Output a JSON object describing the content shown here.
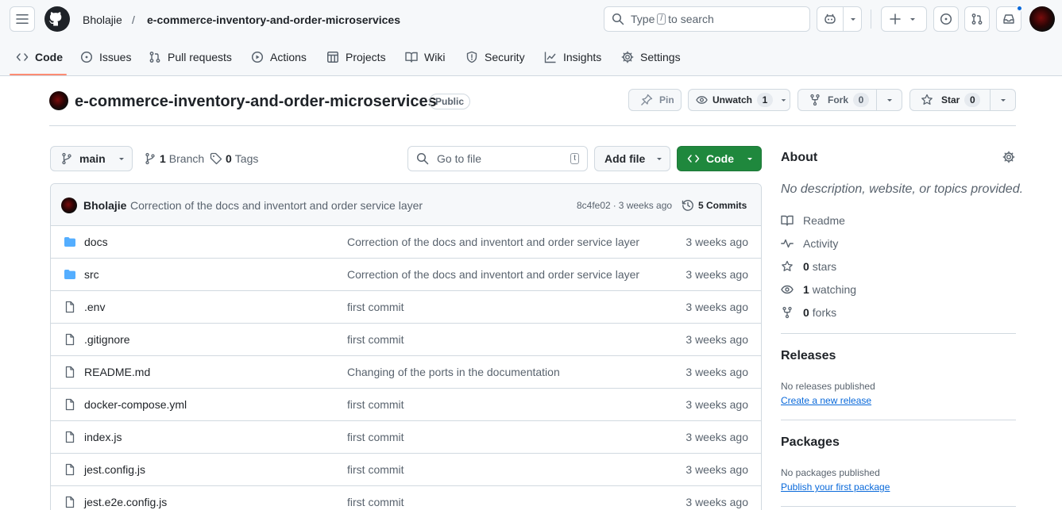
{
  "header": {
    "owner": "Bholajie",
    "separator": "/",
    "repo": "e-commerce-inventory-and-order-microservices",
    "search": {
      "prefix": "Type",
      "key": "/",
      "suffix": "to search"
    }
  },
  "tabs": [
    {
      "label": "Code",
      "icon": "code-icon",
      "active": true
    },
    {
      "label": "Issues",
      "icon": "issue-icon"
    },
    {
      "label": "Pull requests",
      "icon": "pull-request-icon"
    },
    {
      "label": "Actions",
      "icon": "play-icon"
    },
    {
      "label": "Projects",
      "icon": "table-icon"
    },
    {
      "label": "Wiki",
      "icon": "book-icon"
    },
    {
      "label": "Security",
      "icon": "shield-icon"
    },
    {
      "label": "Insights",
      "icon": "graph-icon"
    },
    {
      "label": "Settings",
      "icon": "gear-icon"
    }
  ],
  "repo": {
    "title": "e-commerce-inventory-and-order-microservices",
    "visibility": "Public",
    "actions": {
      "pin": "Pin",
      "unwatch": "Unwatch",
      "watch_count": "1",
      "fork": "Fork",
      "fork_count": "0",
      "star": "Star",
      "star_count": "0"
    }
  },
  "toolbar": {
    "branch": "main",
    "branches_count": "1",
    "branches_label": "Branch",
    "tags_count": "0",
    "tags_label": "Tags",
    "goto_placeholder": "Go to file",
    "goto_key": "t",
    "add_file": "Add file",
    "code": "Code"
  },
  "latest_commit": {
    "author": "Bholajie",
    "message": "Correction of the docs and inventort and order service layer",
    "hash": "8c4fe02",
    "dot": "·",
    "time": "3 weeks ago",
    "commits": "5 Commits"
  },
  "files": [
    {
      "name": "docs",
      "type": "dir",
      "message": "Correction of the docs and inventort and order service layer",
      "date": "3 weeks ago"
    },
    {
      "name": "src",
      "type": "dir",
      "message": "Correction of the docs and inventort and order service layer",
      "date": "3 weeks ago"
    },
    {
      "name": ".env",
      "type": "file",
      "message": "first commit",
      "date": "3 weeks ago"
    },
    {
      "name": ".gitignore",
      "type": "file",
      "message": "first commit",
      "date": "3 weeks ago"
    },
    {
      "name": "README.md",
      "type": "file",
      "message": "Changing of the ports in the documentation",
      "date": "3 weeks ago"
    },
    {
      "name": "docker-compose.yml",
      "type": "file",
      "message": "first commit",
      "date": "3 weeks ago"
    },
    {
      "name": "index.js",
      "type": "file",
      "message": "first commit",
      "date": "3 weeks ago"
    },
    {
      "name": "jest.config.js",
      "type": "file",
      "message": "first commit",
      "date": "3 weeks ago"
    },
    {
      "name": "jest.e2e.config.js",
      "type": "file",
      "message": "first commit",
      "date": "3 weeks ago"
    }
  ],
  "about": {
    "heading": "About",
    "description": "No description, website, or topics provided.",
    "readme": "Readme",
    "activity": "Activity",
    "stars_count": "0",
    "stars_label": "stars",
    "watching_count": "1",
    "watching_label": "watching",
    "forks_count": "0",
    "forks_label": "forks"
  },
  "releases": {
    "heading": "Releases",
    "empty": "No releases published",
    "link": "Create a new release"
  },
  "packages": {
    "heading": "Packages",
    "empty": "No packages published",
    "link": "Publish your first package"
  },
  "colors": {
    "accent_green": "#1f883d",
    "tab_underline": "#fd8c73",
    "link_blue": "#0969da",
    "folder_blue": "#54aeff",
    "notification_dot": "#0969da"
  }
}
